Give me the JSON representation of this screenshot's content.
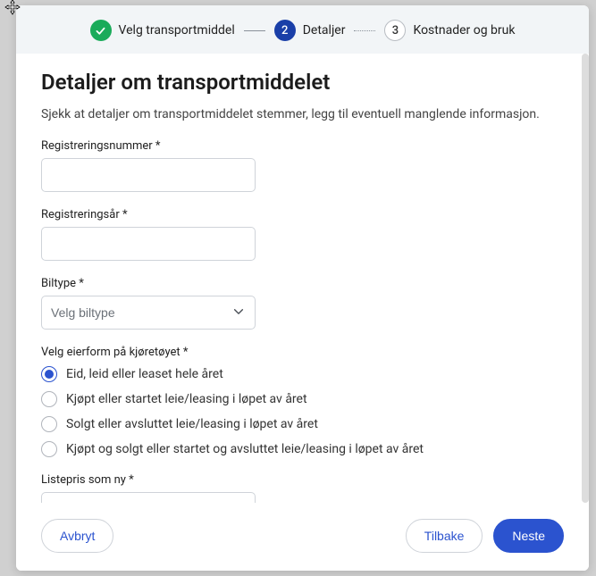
{
  "stepper": {
    "step1": {
      "label": "Velg transportmiddel"
    },
    "step2": {
      "number": "2",
      "label": "Detaljer"
    },
    "step3": {
      "number": "3",
      "label": "Kostnader og bruk"
    }
  },
  "page": {
    "title": "Detaljer om transportmiddelet",
    "description": "Sjekk at detaljer om transportmiddelet stemmer, legg til eventuell manglende informasjon."
  },
  "form": {
    "regnr_label": "Registreringsnummer *",
    "regnr_value": "",
    "regaar_label": "Registreringsår *",
    "regaar_value": "",
    "biltype_label": "Biltype *",
    "biltype_placeholder": "Velg biltype",
    "eierform_label": "Velg eierform på kjøretøyet *",
    "eierform_options": {
      "opt1": "Eid, leid eller leaset hele året",
      "opt2": "Kjøpt eller startet leie/leasing i løpet av året",
      "opt3": "Solgt eller avsluttet leie/leasing i løpet av året",
      "opt4": "Kjøpt og solgt eller startet og avsluttet leie/leasing i løpet av året"
    },
    "eierform_selected": "opt1",
    "listepris_label": "Listepris som ny *",
    "listepris_value": ""
  },
  "buttons": {
    "cancel": "Avbryt",
    "back": "Tilbake",
    "next": "Neste"
  }
}
